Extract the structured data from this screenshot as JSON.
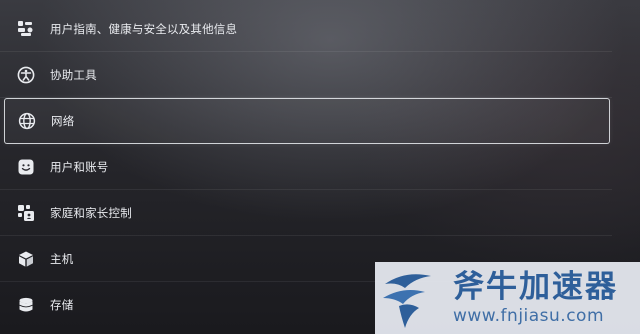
{
  "settings_menu": {
    "items": [
      {
        "label": "用户指南、健康与安全以及其他信息",
        "icon": "info-blocks-icon"
      },
      {
        "label": "协助工具",
        "icon": "accessibility-icon"
      },
      {
        "label": "网络",
        "icon": "globe-icon",
        "selected": true
      },
      {
        "label": "用户和账号",
        "icon": "smiley-face-icon"
      },
      {
        "label": "家庭和家长控制",
        "icon": "family-controls-icon"
      },
      {
        "label": "主机",
        "icon": "console-cube-icon"
      },
      {
        "label": "存储",
        "icon": "storage-cylinder-icon"
      }
    ]
  },
  "watermark": {
    "brand_name": "斧牛加速器",
    "url": "www.fnjiasu.com",
    "brand_color": "#2e5f9a"
  },
  "colors": {
    "text": "#e9ebef",
    "selection_border": "#ebeef2"
  }
}
